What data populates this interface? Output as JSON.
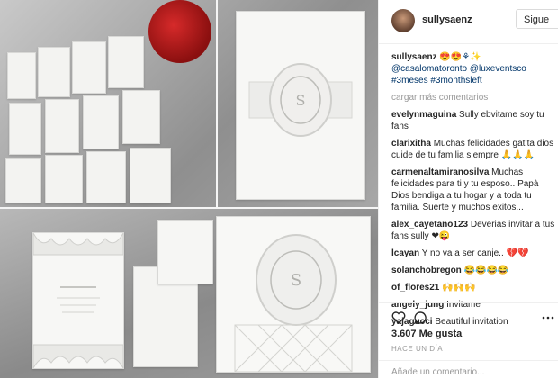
{
  "post": {
    "username": "sullysaenz",
    "follow_label": "Sigue",
    "caption_user": "sullysaenz",
    "caption_text": "😍😍⚘✨ @casalomatoronto @luxeventsco #3meses #3monthsleft",
    "load_more": "cargar más comentarios",
    "likes": "3.607 Me gusta",
    "time": "HACE UN DÍA",
    "add_comment": "Añade un comentario..."
  },
  "comments": [
    {
      "user": "evelynmaguina",
      "text": "Sully ebvitame soy tu fans"
    },
    {
      "user": "clarixitha",
      "text": "Muchas felicidades gatita dios cuide de tu familia siempre 🙏🙏🙏"
    },
    {
      "user": "carmenaltamiranosilva",
      "text": "Muchas felicidades para ti y tu esposo.. Papà Dios bendiga a tu hogar y a toda tu familia. Suerte y muchos exitos..."
    },
    {
      "user": "alex_cayetano123",
      "text": "Deverias invitar a tus fans sully ❤😜"
    },
    {
      "user": "lcayan",
      "text": "Y no va a ser canje.. 💔💔"
    },
    {
      "user": "solanchobregon",
      "text": "😂😂😂😂"
    },
    {
      "user": "of_flores21",
      "text": "🙌🙌🙌"
    },
    {
      "user": "angely_jung",
      "text": "Invitame"
    },
    {
      "user": "yajagucci",
      "text": "Beautiful invitation"
    }
  ],
  "icons": {
    "like": "heart-icon",
    "comment": "comment-icon",
    "more": "ellipsis-icon"
  },
  "colors": {
    "username": "#262626",
    "link": "#003569",
    "muted": "#999999",
    "border": "#efefef"
  }
}
